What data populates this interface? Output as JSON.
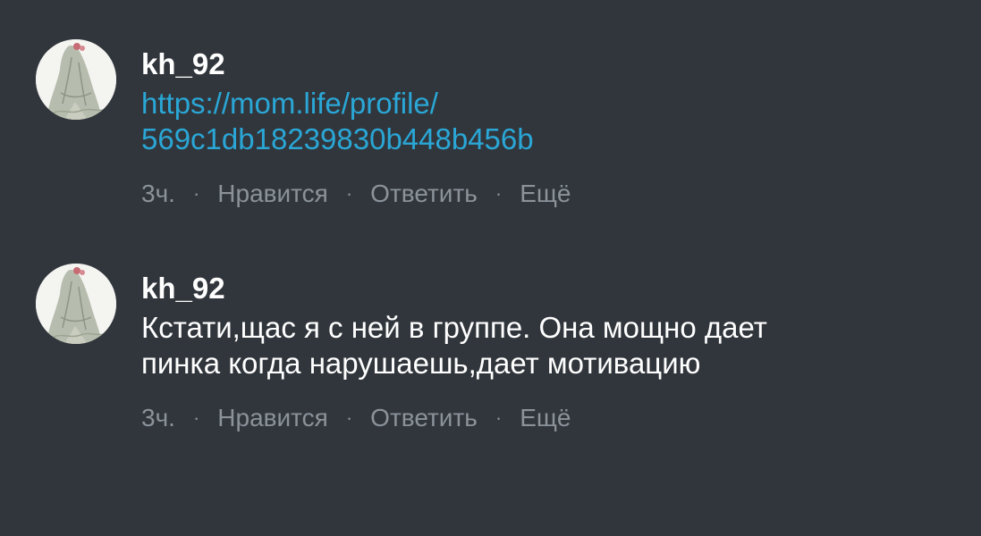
{
  "comments": [
    {
      "username": "kh_92",
      "link_lines": [
        "https://mom.life/profile/",
        "569c1db18239830b448b456b"
      ],
      "time": "3ч.",
      "like": "Нравится",
      "reply": "Ответить",
      "more": "Ещё"
    },
    {
      "username": "kh_92",
      "text_lines": [
        "Кстати,щас я с ней в группе. Она мощно дает",
        "пинка когда нарушаешь,дает мотивацию"
      ],
      "time": "3ч.",
      "like": "Нравится",
      "reply": "Ответить",
      "more": "Ещё"
    }
  ],
  "separator": "·",
  "colors": {
    "background": "#31363c",
    "username": "#ffffff",
    "text": "#ffffff",
    "link": "#2aa7d6",
    "meta": "#8b929a"
  },
  "icons": {
    "avatar": "avatar-figure-icon"
  }
}
